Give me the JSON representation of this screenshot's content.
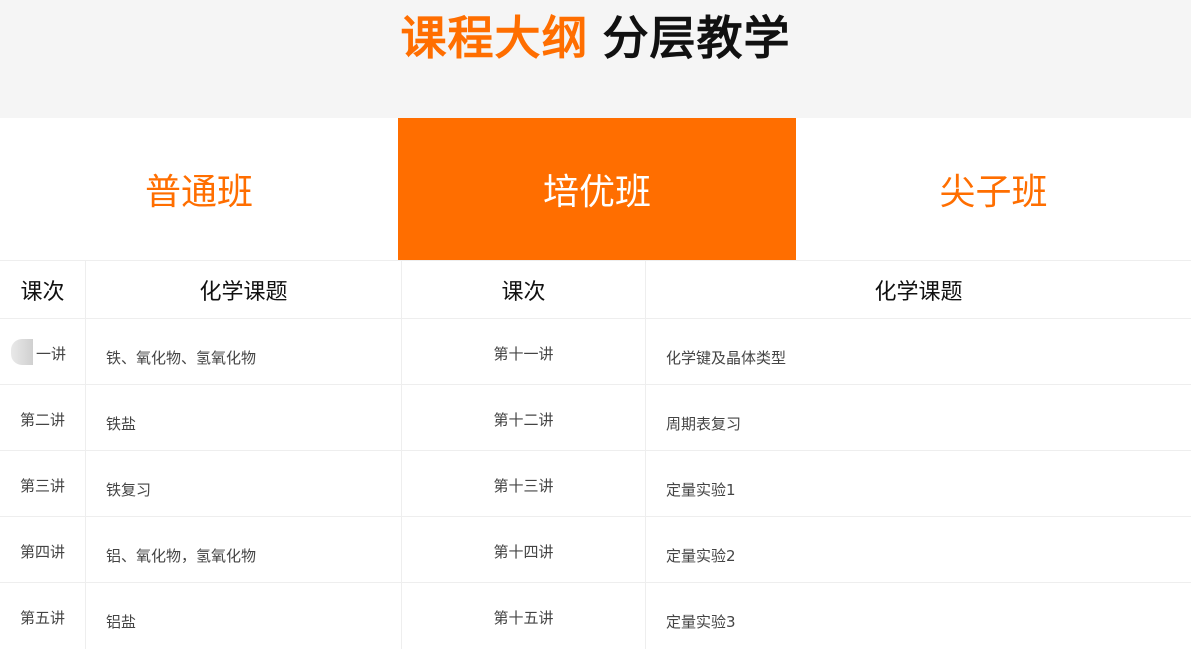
{
  "header": {
    "title_highlight": "课程大纲",
    "title_rest": "分层教学"
  },
  "tabs": [
    {
      "label": "普通班",
      "active": false
    },
    {
      "label": "培优班",
      "active": true
    },
    {
      "label": "尖子班",
      "active": false
    }
  ],
  "colors": {
    "accent": "#ff6e00",
    "header_bg": "#f5f5f5",
    "text": "#444444",
    "divider": "#eeeeee"
  },
  "table": {
    "headers": [
      "课次",
      "化学课题",
      "课次",
      "化学课题"
    ],
    "rows": [
      [
        "一讲",
        "铁、氧化物、氢氧化物",
        "第十一讲",
        "化学键及晶体类型"
      ],
      [
        "第二讲",
        "铁盐",
        "第十二讲",
        "周期表复习"
      ],
      [
        "第三讲",
        "铁复习",
        "第十三讲",
        "定量实验1"
      ],
      [
        "第四讲",
        "铝、氧化物，氢氧化物",
        "第十四讲",
        "定量实验2"
      ],
      [
        "第五讲",
        "铝盐",
        "第十五讲",
        "定量实验3"
      ]
    ]
  }
}
